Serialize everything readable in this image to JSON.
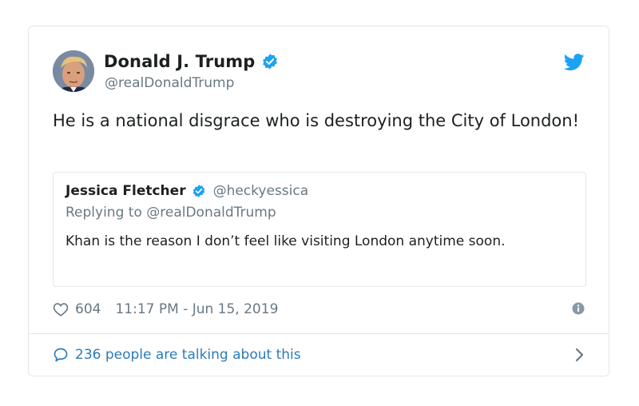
{
  "tweet": {
    "author": {
      "display_name": "Donald J. Trump",
      "handle": "@realDonaldTrump",
      "verified": true,
      "avatar_icon": "avatar-photo"
    },
    "text": "He is a national disgrace who is destroying the City of London!",
    "quoted": {
      "display_name": "Jessica Fletcher",
      "handle": "@heckyessica",
      "verified": true,
      "replying_to": "Replying to @realDonaldTrump",
      "text": "Khan is the reason I don’t feel like visiting London anytime soon."
    },
    "likes": "604",
    "timestamp": "11:17 PM - Jun 15, 2019",
    "talking": "236 people are talking about this"
  },
  "colors": {
    "brand_blue": "#1da1f2",
    "link_blue": "#2b7bb9",
    "secondary_text": "#697882",
    "border": "#e1e8ed"
  },
  "icons": {
    "brand": "twitter-bird-icon",
    "verified": "verified-badge-icon",
    "like": "heart-icon",
    "info": "info-icon",
    "reply": "speech-bubble-icon",
    "more": "chevron-right-icon"
  }
}
